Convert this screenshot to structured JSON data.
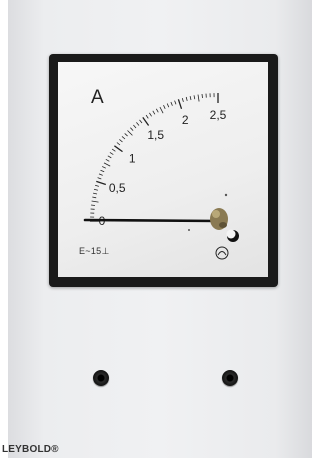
{
  "meter": {
    "unit": "A",
    "scale_labels": [
      "0",
      "0,5",
      "1",
      "1,5",
      "2",
      "2,5"
    ],
    "scale_values": [
      0,
      0.5,
      1,
      1.5,
      2,
      2.5
    ],
    "scale_max": 2.5,
    "needle_value": 0,
    "symbol_text": "E~15⊥",
    "zero_adjust_icon": "zero-adjust-screw-icon"
  },
  "panel": {
    "brand": "LEYBOLD®",
    "fine_print": [
      "",
      ""
    ],
    "jacks": [
      "left-socket",
      "right-socket"
    ]
  },
  "colors": {
    "panel": "#eeeff1",
    "frame": "#1a1a1a",
    "face": "#f2f2f2",
    "scale": "#222222",
    "jack": "#111111"
  }
}
